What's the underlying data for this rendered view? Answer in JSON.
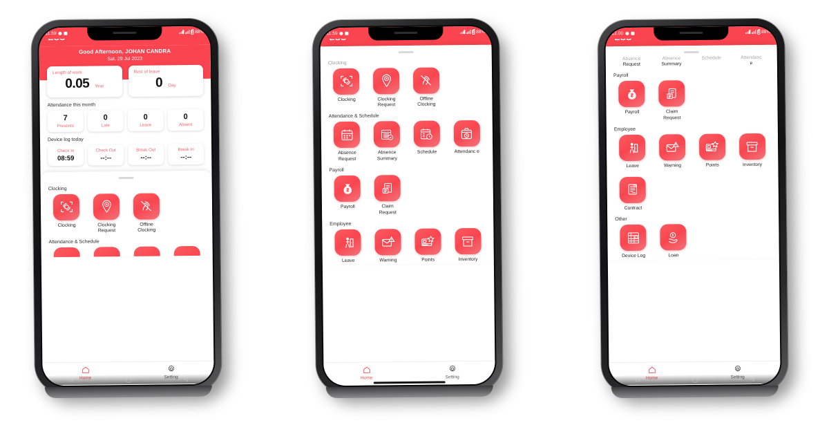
{
  "app": {
    "name": "ESS",
    "accent": "#F9454F",
    "header_red": "#FA444F"
  },
  "phones": [
    {
      "id": "phone-1",
      "status": {
        "time": "11.59",
        "battery": "88%"
      },
      "hero": {
        "greeting": "Good Afternoon, JOHAN CANDRA",
        "date": "Sat, 29 Jul 2023"
      },
      "summary": [
        {
          "caption": "Length of work",
          "value": "0.05",
          "unit": "Year"
        },
        {
          "caption": "Rest of leave",
          "value": "0",
          "unit": "Day"
        }
      ],
      "attendance": {
        "title": "Attendance this month",
        "items": [
          {
            "num": "7",
            "label": "Presents"
          },
          {
            "num": "0",
            "label": "Late"
          },
          {
            "num": "0",
            "label": "Leave"
          },
          {
            "num": "0",
            "label": "Absent"
          }
        ]
      },
      "devicelog": {
        "title": "Device log today",
        "items": [
          {
            "label": "Check In",
            "value": "08:59"
          },
          {
            "label": "Check Out",
            "value": "--:--"
          },
          {
            "label": "Break Out",
            "value": "--:--"
          },
          {
            "label": "Break In",
            "value": "--:--"
          }
        ]
      },
      "menu_section_1": {
        "title": "Clocking",
        "items": [
          {
            "label": "Clocking",
            "icon": "fingerprint-scan-icon"
          },
          {
            "label": "Clocking Request",
            "icon": "location-pin-icon"
          },
          {
            "label": "Offline Clocking",
            "icon": "offline-clocking-icon"
          }
        ]
      },
      "menu_section_2": {
        "title": "Attendance & Schedule",
        "cut_labels": [
          {
            "top": "",
            "bot": ""
          },
          {
            "top": "",
            "bot": ""
          },
          {
            "top": "",
            "bot": ""
          },
          {
            "top": "",
            "bot": ""
          }
        ]
      },
      "nav": [
        {
          "label": "Home",
          "icon": "home-icon",
          "active": true
        },
        {
          "label": "Setting",
          "icon": "gear-icon",
          "active": false
        }
      ]
    },
    {
      "id": "phone-2",
      "status": {
        "time": "11.59",
        "battery": "88%"
      },
      "sections": [
        {
          "title": "Clocking",
          "dim": true,
          "items": [
            {
              "label": "Clocking",
              "icon": "fingerprint-scan-icon"
            },
            {
              "label": "Clocking Request",
              "icon": "location-pin-icon"
            },
            {
              "label": "Offline Clocking",
              "icon": "offline-clocking-icon"
            }
          ]
        },
        {
          "title": "Attendance & Schedule",
          "dim": false,
          "items": [
            {
              "label": "Absence Request",
              "icon": "calendar-icon"
            },
            {
              "label": "Absence Summary",
              "icon": "calendar-summary-icon"
            },
            {
              "label": "Schedule",
              "icon": "calendar-clock-icon"
            },
            {
              "label": "Attendanc e",
              "icon": "attendance-clock-icon"
            }
          ]
        },
        {
          "title": "Payroll",
          "dim": false,
          "items": [
            {
              "label": "Payroll",
              "icon": "money-bag-icon"
            },
            {
              "label": "Claim Request",
              "icon": "claim-document-icon"
            }
          ]
        },
        {
          "title": "Employee",
          "dim": false,
          "items": [
            {
              "label": "Leave",
              "icon": "leave-person-icon"
            },
            {
              "label": "Warning",
              "icon": "warning-envelope-icon"
            },
            {
              "label": "Points",
              "icon": "points-card-icon"
            },
            {
              "label": "Inventory",
              "icon": "inventory-box-icon"
            }
          ]
        }
      ],
      "nav": [
        {
          "label": "Home",
          "icon": "home-icon",
          "active": true
        },
        {
          "label": "Setting",
          "icon": "gear-icon",
          "active": false
        }
      ]
    },
    {
      "id": "phone-3",
      "status": {
        "time": "12.00",
        "battery": "88%"
      },
      "cut_labels": [
        {
          "top": "Absence",
          "bot": "Request"
        },
        {
          "top": "Absence",
          "bot": "Summary"
        },
        {
          "top": "Schedule",
          "bot": ""
        },
        {
          "top": "Attendanc",
          "bot": "e"
        }
      ],
      "sections": [
        {
          "title": "Payroll",
          "dim": false,
          "items": [
            {
              "label": "Payroll",
              "icon": "money-bag-icon"
            },
            {
              "label": "Claim Request",
              "icon": "claim-document-icon"
            }
          ]
        },
        {
          "title": "Employee",
          "dim": false,
          "items": [
            {
              "label": "Leave",
              "icon": "leave-person-icon"
            },
            {
              "label": "Warning",
              "icon": "warning-envelope-icon"
            },
            {
              "label": "Points",
              "icon": "points-card-icon"
            },
            {
              "label": "Inventory",
              "icon": "inventory-box-icon"
            },
            {
              "label": "Contract",
              "icon": "contract-icon"
            }
          ]
        },
        {
          "title": "Other",
          "dim": false,
          "items": [
            {
              "label": "Device Log",
              "icon": "device-log-icon"
            },
            {
              "label": "Loan",
              "icon": "loan-icon"
            }
          ]
        }
      ],
      "nav": [
        {
          "label": "Home",
          "icon": "home-icon",
          "active": true
        },
        {
          "label": "Setting",
          "icon": "gear-icon",
          "active": false
        }
      ]
    }
  ]
}
